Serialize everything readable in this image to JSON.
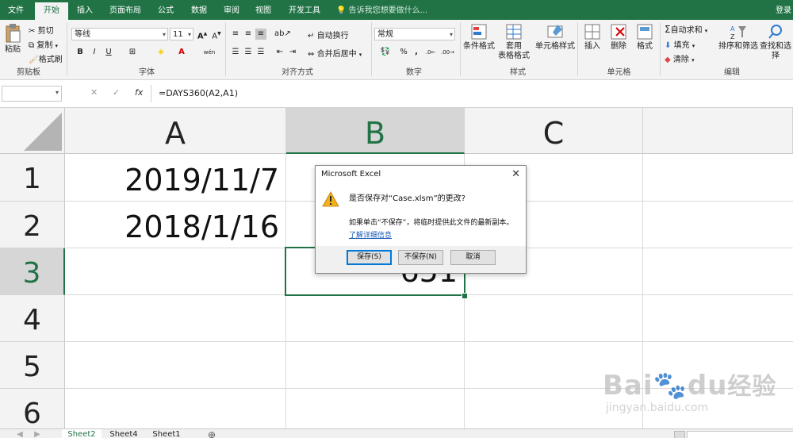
{
  "tabs": [
    "文件",
    "开始",
    "插入",
    "页面布局",
    "公式",
    "数据",
    "审阅",
    "视图",
    "开发工具"
  ],
  "active_tab": "开始",
  "tell_me": "告诉我您想要做什么...",
  "login": "登录",
  "ribbon": {
    "clipboard": {
      "paste": "粘贴",
      "cut": "剪切",
      "copy": "复制",
      "format_painter": "格式刷",
      "label": "剪贴板"
    },
    "font": {
      "name": "等线",
      "size": "11",
      "bold": "B",
      "italic": "I",
      "underline": "U",
      "phonetic": "wén",
      "label": "字体",
      "grow": "A",
      "shrink": "A"
    },
    "alignment": {
      "wrap": "自动换行",
      "merge": "合并后居中",
      "label": "对齐方式"
    },
    "number": {
      "format": "常规",
      "percent": "%",
      "comma": ",",
      "label": "数字"
    },
    "styles": {
      "conditional": "条件格式",
      "table_line1": "套用",
      "table_line2": "表格格式",
      "cell_styles": "单元格样式",
      "label": "样式"
    },
    "cells": {
      "insert": "插入",
      "delete": "删除",
      "format": "格式",
      "label": "单元格"
    },
    "editing": {
      "autosum": "自动求和",
      "fill": "填充",
      "clear": "清除",
      "sort": "排序和筛选",
      "find": "查找和选择",
      "label": "编辑"
    }
  },
  "formula_bar": {
    "name_box": "",
    "cancel": "✕",
    "enter": "✓",
    "fx": "fx",
    "formula": "=DAYS360(A2,A1)"
  },
  "columns": [
    "A",
    "B",
    "C"
  ],
  "rows": [
    "1",
    "2",
    "3",
    "4",
    "5",
    "6"
  ],
  "cells": {
    "A1": "2019/11/7",
    "A2": "2018/1/16",
    "B3": "651"
  },
  "sheets": [
    "Sheet2",
    "Sheet4",
    "Sheet1"
  ],
  "active_sheet": "Sheet2",
  "dialog": {
    "title": "Microsoft Excel",
    "question": "是否保存对“Case.xlsm”的更改?",
    "info": "如果单击“不保存”，将临时提供此文件的最新副本。",
    "link": "了解详细信息",
    "buttons": {
      "save": "保存(S)",
      "dont_save": "不保存(N)",
      "cancel": "取消"
    }
  },
  "watermark": {
    "brand": "Bai",
    "brand2": "du",
    "product": "经验",
    "url": "jingyan.baidu.com"
  },
  "colors": {
    "accent": "#217346",
    "link": "#1a5bb5",
    "warn": "#f2b01e"
  }
}
